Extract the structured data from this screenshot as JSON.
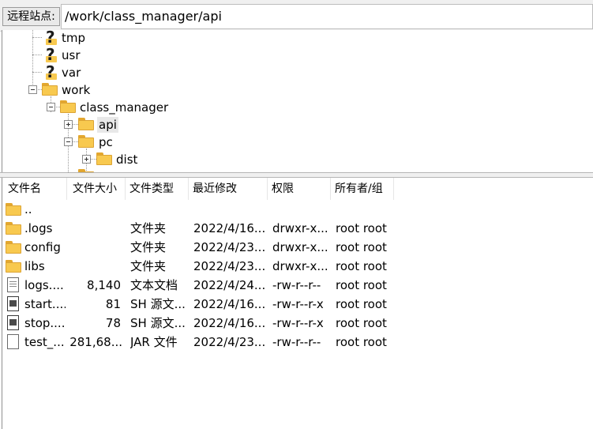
{
  "address_bar": {
    "label": "远程站点:",
    "path": "/work/class_manager/api"
  },
  "tree": {
    "nodes": [
      {
        "label": "tmp",
        "icon": "unknown-folder-icon"
      },
      {
        "label": "usr",
        "icon": "unknown-folder-icon"
      },
      {
        "label": "var",
        "icon": "unknown-folder-icon"
      },
      {
        "label": "work",
        "icon": "folder-icon",
        "expanded": true
      },
      {
        "label": "class_manager",
        "icon": "folder-icon",
        "expanded": true
      },
      {
        "label": "api",
        "icon": "folder-icon",
        "expanded": false,
        "selected": true
      },
      {
        "label": "pc",
        "icon": "folder-icon",
        "expanded": true
      },
      {
        "label": "dist",
        "icon": "folder-icon",
        "expanded": false
      }
    ]
  },
  "file_list": {
    "columns": [
      "文件名",
      "文件大小",
      "文件类型",
      "最近修改",
      "权限",
      "所有者/组"
    ],
    "rows": [
      {
        "name": "..",
        "size": "",
        "type": "",
        "modified": "",
        "perms": "",
        "owner": "",
        "icon": "folder-icon"
      },
      {
        "name": ".logs",
        "size": "",
        "type": "文件夹",
        "modified": "2022/4/16...",
        "perms": "drwxr-x...",
        "owner": "root root",
        "icon": "folder-icon"
      },
      {
        "name": "config",
        "size": "",
        "type": "文件夹",
        "modified": "2022/4/23...",
        "perms": "drwxr-x...",
        "owner": "root root",
        "icon": "folder-icon"
      },
      {
        "name": "libs",
        "size": "",
        "type": "文件夹",
        "modified": "2022/4/23...",
        "perms": "drwxr-x...",
        "owner": "root root",
        "icon": "folder-icon"
      },
      {
        "name": "logs....",
        "size": "8,140",
        "type": "文本文档",
        "modified": "2022/4/24...",
        "perms": "-rw-r--r--",
        "owner": "root root",
        "icon": "text-document-icon"
      },
      {
        "name": "start....",
        "size": "81",
        "type": "SH 源文...",
        "modified": "2022/4/16...",
        "perms": "-rw-r--r-x",
        "owner": "root root",
        "icon": "shell-script-icon"
      },
      {
        "name": "stop....",
        "size": "78",
        "type": "SH 源文...",
        "modified": "2022/4/16...",
        "perms": "-rw-r--r-x",
        "owner": "root root",
        "icon": "shell-script-icon"
      },
      {
        "name": "test_...",
        "size": "281,68...",
        "type": "JAR 文件",
        "modified": "2022/4/23...",
        "perms": "-rw-r--r--",
        "owner": "root root",
        "icon": "jar-file-icon"
      }
    ]
  }
}
